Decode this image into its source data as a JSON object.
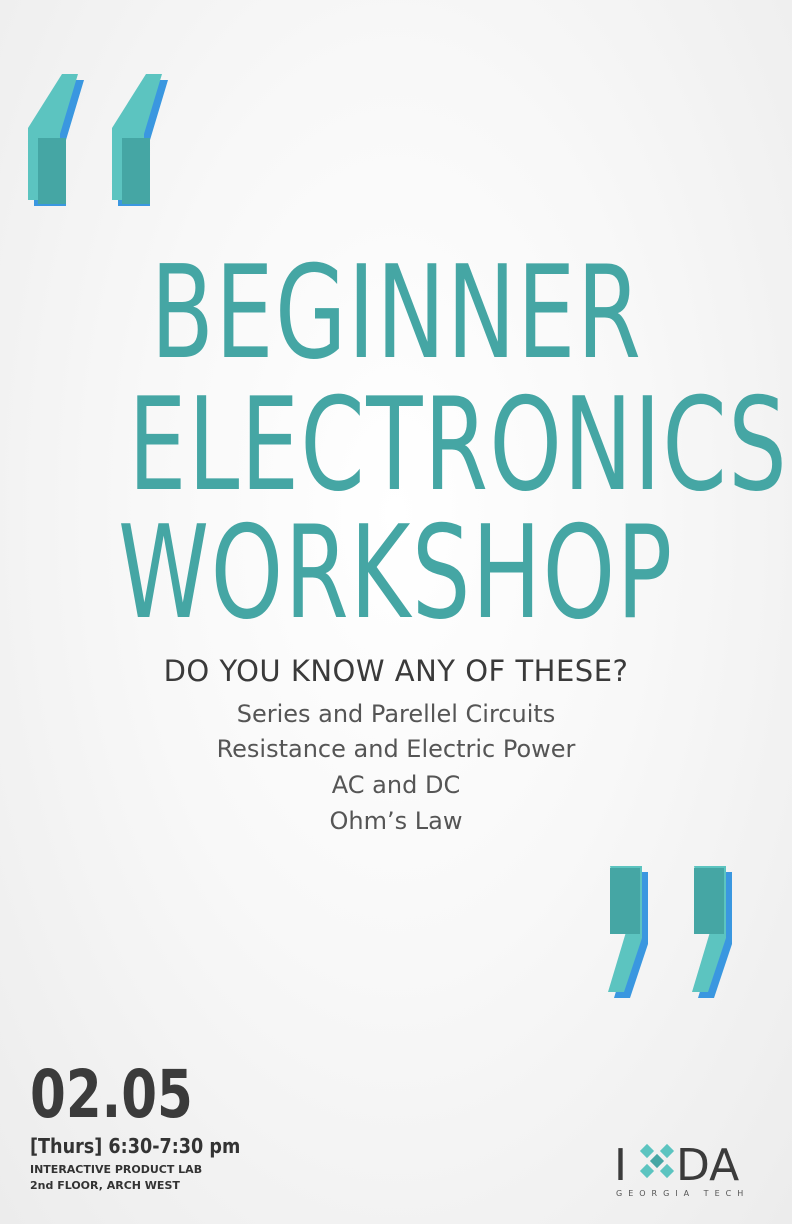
{
  "title_lines": [
    "BEGINNER",
    "ELECTRONICS",
    "WORKSHOP"
  ],
  "question": "DO YOU KNOW ANY OF THESE?",
  "topics": [
    "Series and Parellel Circuits",
    "Resistance and Electric Power",
    "AC and DC",
    "Ohm’s Law"
  ],
  "event": {
    "date": "02.05",
    "time": "[Thurs] 6:30-7:30 pm",
    "location_line1": "INTERACTIVE PRODUCT LAB",
    "location_line2": "2nd FLOOR, ARCH WEST"
  },
  "logo": {
    "letters_left": "I",
    "letters_right": "DA",
    "subtitle": "GEORGIA TECH"
  },
  "colors": {
    "teal": "#45a6a4",
    "light_teal": "#5cc4c0",
    "blue_shadow": "#3a97e0",
    "dark_text": "#3a3a3a"
  }
}
